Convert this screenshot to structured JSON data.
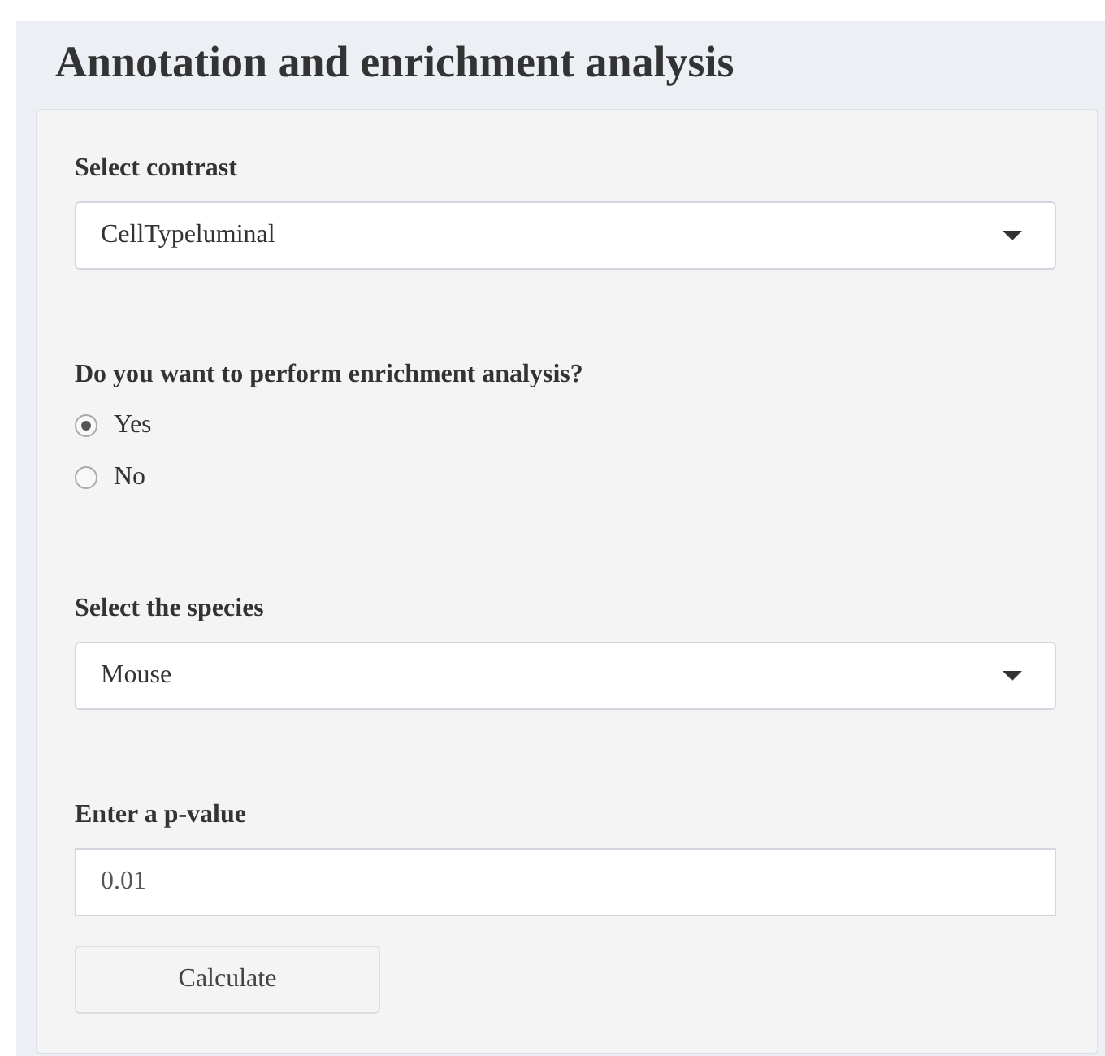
{
  "title": "Annotation and enrichment analysis",
  "fields": [
    {
      "kind": "select",
      "label": "Select contrast",
      "value": "CellTypeluminal"
    },
    {
      "kind": "radio",
      "label": "Do you want to perform enrichment analysis?",
      "options": [
        {
          "label": "Yes",
          "selected": true
        },
        {
          "label": "No",
          "selected": false
        }
      ]
    },
    {
      "kind": "select",
      "label": "Select the species",
      "value": "Mouse"
    },
    {
      "kind": "text",
      "label": "Enter a p-value",
      "value": "0.01"
    }
  ],
  "button": "Calculate"
}
